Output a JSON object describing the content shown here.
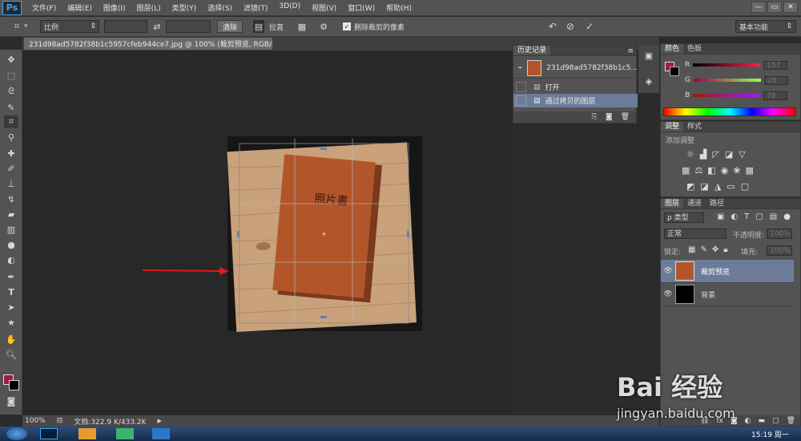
{
  "app": {
    "logo": "Ps"
  },
  "menu": [
    "文件(F)",
    "编辑(E)",
    "图像(I)",
    "图层(L)",
    "类型(Y)",
    "选择(S)",
    "滤镜(T)",
    "3D(D)",
    "视图(V)",
    "窗口(W)",
    "帮助(H)"
  ],
  "window_controls": [
    "—",
    "▭",
    "✕"
  ],
  "options": {
    "ratio_label": "比例",
    "clear_label": "清除",
    "straighten_label": "拉直",
    "delete_cropped_label": "删除裁剪的像素",
    "delete_cropped_checked": true,
    "workspace": "基本功能"
  },
  "document": {
    "tab_title": "231d98ad5782f38b1c5957cfeb944ce7.jpg @ 100% (裁剪预览, RGB/8#) *"
  },
  "canvas": {
    "book_title": "照片書",
    "book_color": "#b3552a",
    "wood_color": "#c9a17a"
  },
  "history": {
    "tabs": [
      "历史记录"
    ],
    "snapshot_label": "231d98ad5782f38b1c5...",
    "items": [
      {
        "label": "打开",
        "selected": false
      },
      {
        "label": "通过拷贝的图层",
        "selected": true
      }
    ]
  },
  "color_panel": {
    "tabs": [
      "颜色",
      "色板"
    ],
    "r_label": "R",
    "r_value": "157",
    "g_label": "G",
    "g_value": "28",
    "b_label": "B",
    "b_value": "78",
    "fg_color": "#9d1c4e"
  },
  "adjustments": {
    "tabs": [
      "调整",
      "样式"
    ],
    "title": "添加调整"
  },
  "layers": {
    "tabs": [
      "图层",
      "通道",
      "路径"
    ],
    "filter_label": "ρ 类型",
    "blend_mode": "正常",
    "opacity_label": "不透明度:",
    "opacity_value": "100%",
    "lock_label": "锁定:",
    "fill_label": "填充:",
    "fill_value": "100%",
    "items": [
      {
        "name": "裁剪预览",
        "selected": true
      },
      {
        "name": "背景",
        "selected": false
      }
    ]
  },
  "status": {
    "zoom": "100%",
    "doc_info": "文档:322.9 K/433.2K"
  },
  "taskbar": {
    "time": "15:19 周一"
  },
  "watermark": {
    "brand": "Bai 经验",
    "url": "jingyan.baidu.com"
  }
}
